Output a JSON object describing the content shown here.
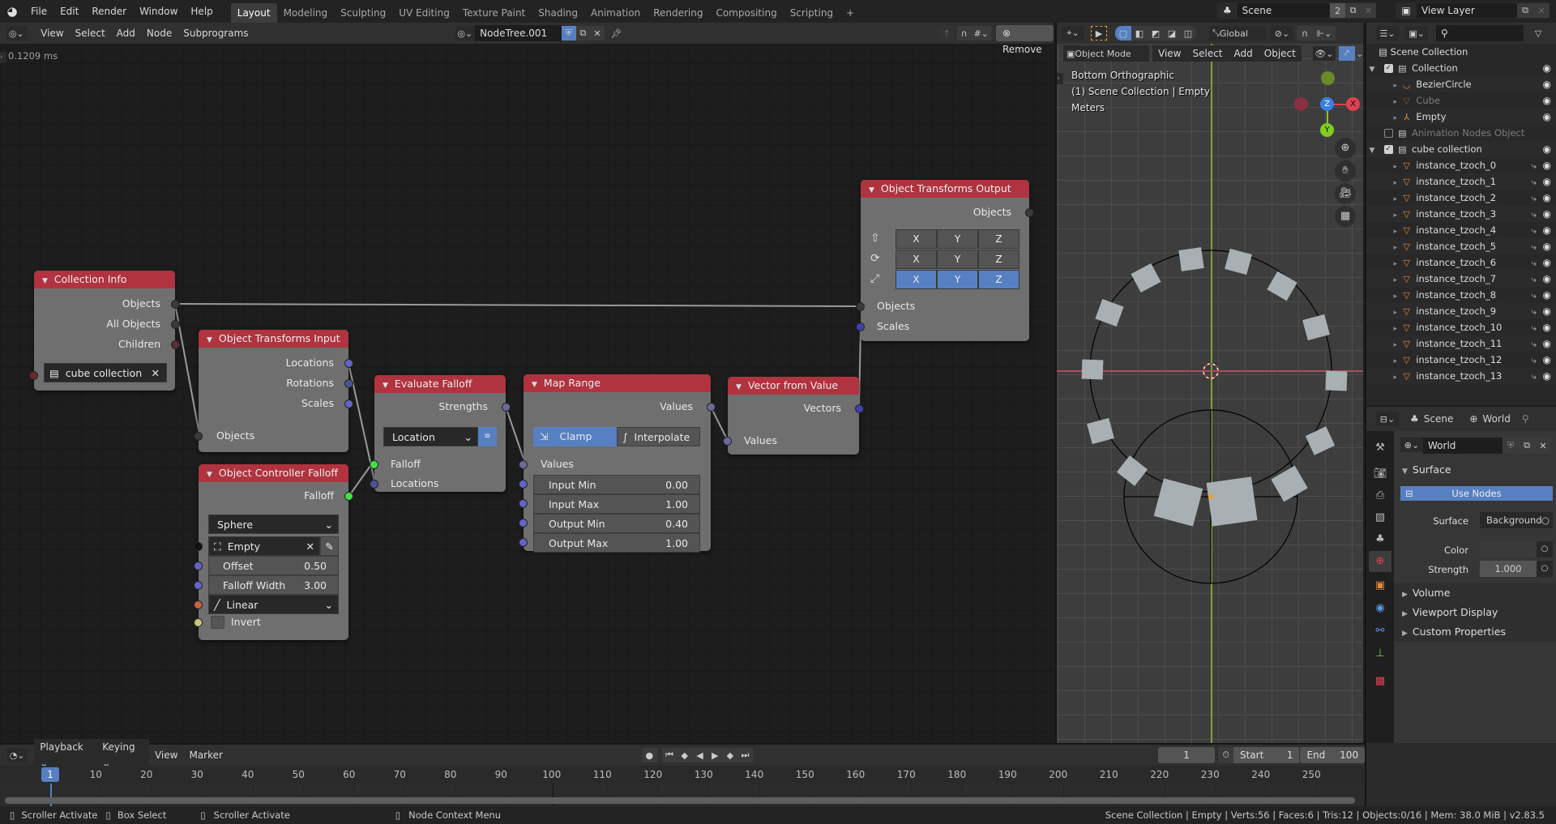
{
  "topbar": {
    "menus": [
      "File",
      "Edit",
      "Render",
      "Window",
      "Help"
    ],
    "workspaces": [
      "Layout",
      "Modeling",
      "Sculpting",
      "UV Editing",
      "Texture Paint",
      "Shading",
      "Animation",
      "Rendering",
      "Compositing",
      "Scripting"
    ],
    "active_workspace": "Layout",
    "add_tab_label": "+",
    "scene_name": "Scene",
    "scene_users": "2",
    "view_layer": "View Layer"
  },
  "node_editor": {
    "menus": [
      "View",
      "Select",
      "Add",
      "Node",
      "Subprograms"
    ],
    "tree_name": "NodeTree.001",
    "remove_label": "Remove",
    "timing": "0.1209 ms",
    "nodes": {
      "collection_info": {
        "title": "Collection Info",
        "outputs": [
          "Objects",
          "All Objects",
          "Children"
        ],
        "collection": "cube collection"
      },
      "transforms_input": {
        "title": "Object Transforms Input",
        "outputs": [
          "Locations",
          "Rotations",
          "Scales"
        ],
        "inputs": [
          "Objects"
        ]
      },
      "controller_falloff": {
        "title": "Object Controller Falloff",
        "outputs": [
          "Falloff"
        ],
        "shape": "Sphere",
        "object": "Empty",
        "offset_label": "Offset",
        "offset": "0.50",
        "width_label": "Falloff Width",
        "width": "3.00",
        "interpolation": "Linear",
        "invert_label": "Invert"
      },
      "evaluate_falloff": {
        "title": "Evaluate Falloff",
        "outputs": [
          "Strengths"
        ],
        "mode": "Location",
        "inputs": [
          "Falloff",
          "Locations"
        ]
      },
      "map_range": {
        "title": "Map Range",
        "outputs": [
          "Values"
        ],
        "clamp_label": "Clamp",
        "interpolate_label": "Interpolate",
        "inputs_label": "Values",
        "fields": [
          {
            "label": "Input Min",
            "value": "0.00"
          },
          {
            "label": "Input Max",
            "value": "1.00"
          },
          {
            "label": "Output Min",
            "value": "0.40"
          },
          {
            "label": "Output Max",
            "value": "1.00"
          }
        ]
      },
      "vector_from_value": {
        "title": "Vector from Value",
        "outputs": [
          "Vectors"
        ],
        "inputs": [
          "Values"
        ]
      },
      "transforms_output": {
        "title": "Object Transforms Output",
        "outputs": [
          "Objects"
        ],
        "axes": [
          "X",
          "Y",
          "Z"
        ],
        "location_enabled": [
          false,
          false,
          false
        ],
        "rotation_enabled": [
          false,
          false,
          false
        ],
        "scale_enabled": [
          true,
          true,
          true
        ],
        "inputs": [
          "Objects",
          "Scales"
        ]
      }
    }
  },
  "viewport": {
    "mode": "Object Mode",
    "menus": [
      "View",
      "Select",
      "Add",
      "Object"
    ],
    "orientation": "Global",
    "view_name": "Bottom Orthographic",
    "collection_info": "(1) Scene Collection | Empty",
    "units": "Meters",
    "gizmo": {
      "x": "X",
      "y": "Y",
      "z": "Z"
    }
  },
  "outliner": {
    "root": "Scene Collection",
    "rows": [
      {
        "name": "Collection",
        "type": "collection",
        "depth": 1
      },
      {
        "name": "BezierCircle",
        "type": "curve",
        "depth": 2
      },
      {
        "name": "Cube",
        "type": "mesh",
        "depth": 2,
        "dim": true
      },
      {
        "name": "Empty",
        "type": "empty",
        "depth": 2
      },
      {
        "name": "Animation Nodes Object",
        "type": "collection",
        "depth": 1,
        "dim": true
      },
      {
        "name": "cube collection",
        "type": "collection",
        "depth": 1
      },
      {
        "name": "instance_tzoch_0",
        "type": "mesh",
        "depth": 2
      },
      {
        "name": "instance_tzoch_1",
        "type": "mesh",
        "depth": 2
      },
      {
        "name": "instance_tzoch_2",
        "type": "mesh",
        "depth": 2
      },
      {
        "name": "instance_tzoch_3",
        "type": "mesh",
        "depth": 2
      },
      {
        "name": "instance_tzoch_4",
        "type": "mesh",
        "depth": 2
      },
      {
        "name": "instance_tzoch_5",
        "type": "mesh",
        "depth": 2
      },
      {
        "name": "instance_tzoch_6",
        "type": "mesh",
        "depth": 2
      },
      {
        "name": "instance_tzoch_7",
        "type": "mesh",
        "depth": 2
      },
      {
        "name": "instance_tzoch_8",
        "type": "mesh",
        "depth": 2
      },
      {
        "name": "instance_tzoch_9",
        "type": "mesh",
        "depth": 2
      },
      {
        "name": "instance_tzoch_10",
        "type": "mesh",
        "depth": 2
      },
      {
        "name": "instance_tzoch_11",
        "type": "mesh",
        "depth": 2
      },
      {
        "name": "instance_tzoch_12",
        "type": "mesh",
        "depth": 2
      },
      {
        "name": "instance_tzoch_13",
        "type": "mesh",
        "depth": 2
      }
    ]
  },
  "properties": {
    "breadcrumb_scene": "Scene",
    "breadcrumb_world": "World",
    "world_name": "World",
    "surface_panel": "Surface",
    "use_nodes_label": "Use Nodes",
    "surface_label": "Surface",
    "surface_value": "Background",
    "color_label": "Color",
    "strength_label": "Strength",
    "strength_value": "1.000",
    "panels": [
      "Volume",
      "Viewport Display",
      "Custom Properties"
    ]
  },
  "timeline": {
    "menus": [
      "Playback",
      "Keying",
      "View",
      "Marker"
    ],
    "current_frame": "1",
    "start_label": "Start",
    "start": "1",
    "end_label": "End",
    "end": "100",
    "ticks": [
      "10",
      "20",
      "30",
      "40",
      "50",
      "60",
      "70",
      "80",
      "90",
      "100",
      "110",
      "120",
      "130",
      "140",
      "150",
      "160",
      "170",
      "180",
      "190",
      "200",
      "210",
      "220",
      "230",
      "240",
      "250"
    ]
  },
  "statusbar": {
    "hints": [
      "Scroller Activate",
      "Box Select",
      "Scroller Activate",
      "Node Context Menu"
    ],
    "info": "Scene Collection | Empty | Verts:56 | Faces:6 | Tris:12 | Objects:0/16 | Mem: 38.0 MiB | v2.83.5"
  },
  "colors": {
    "node_header": "#b0333f",
    "accent_blue": "#5680c2",
    "falloff_socket": "#3ee63e",
    "vector_socket": "#6363c7"
  }
}
